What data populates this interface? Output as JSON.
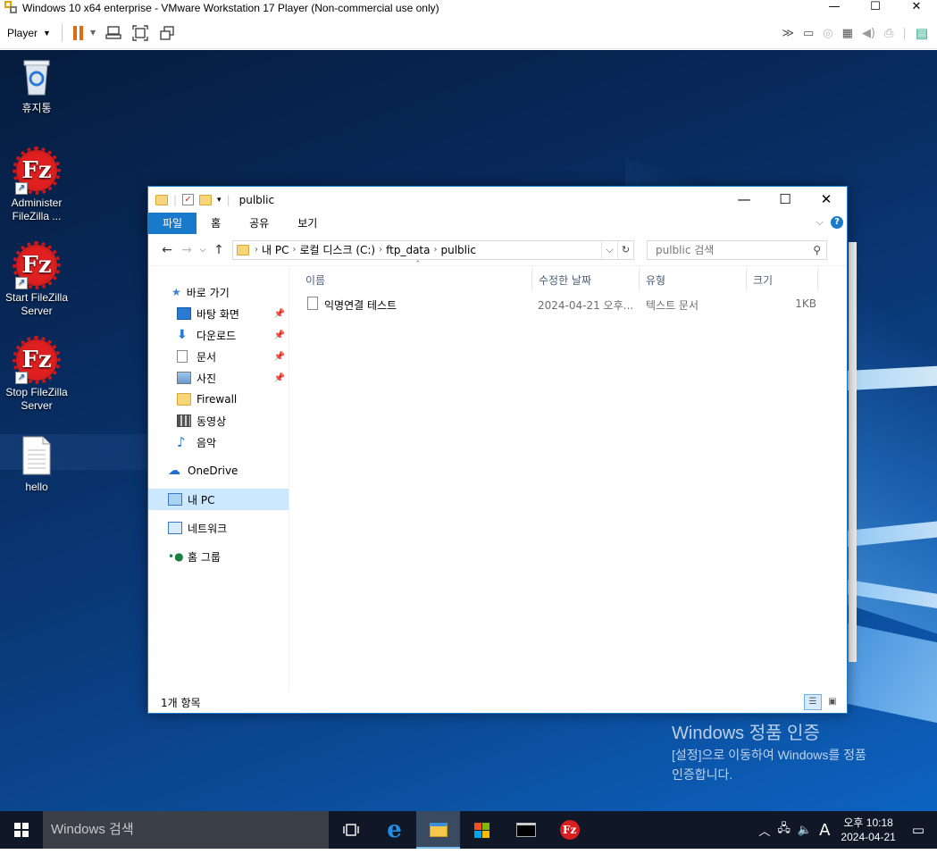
{
  "vm": {
    "title": "Windows 10 x64 enterprise - VMware Workstation 17 Player (Non-commercial use only)",
    "player_menu": "Player",
    "min_glyph": "—",
    "max_glyph": "☐",
    "close_glyph": "✕"
  },
  "desktop": {
    "icons": [
      {
        "label": "휴지통",
        "icon": "recycle-bin-icon"
      },
      {
        "label": "Administer FileZilla ...",
        "icon": "filezilla-icon"
      },
      {
        "label": "Start FileZilla Server",
        "icon": "filezilla-icon"
      },
      {
        "label": "Stop FileZilla Server",
        "icon": "filezilla-icon"
      },
      {
        "label": "hello",
        "icon": "text-file-icon"
      }
    ],
    "watermark_title": "Windows 정품 인증",
    "watermark_line1": "[설정]으로 이동하여 Windows를 정품",
    "watermark_line2": "인증합니다."
  },
  "explorer": {
    "title": "pulblic",
    "tabs": [
      "파일",
      "홈",
      "공유",
      "보기"
    ],
    "breadcrumb": [
      "내 PC",
      "로컬 디스크 (C:)",
      "ftp_data",
      "pulblic"
    ],
    "search_placeholder": "pulblic 검색",
    "nav": {
      "quick_access": "바로 가기",
      "items": [
        "바탕 화면",
        "다운로드",
        "문서",
        "사진",
        "Firewall",
        "동영상",
        "음악"
      ],
      "onedrive": "OneDrive",
      "this_pc": "내 PC",
      "network": "네트워크",
      "homegroup": "홈 그룹"
    },
    "columns": [
      "이름",
      "수정한 날짜",
      "유형",
      "크기"
    ],
    "files": [
      {
        "name": "익명연결 테스트",
        "modified": "2024-04-21 오후...",
        "type": "텍스트 문서",
        "size": "1KB"
      }
    ],
    "status": "1개 항목"
  },
  "taskbar": {
    "search_placeholder": "Windows 검색",
    "ime": "A",
    "time": "오후 10:18",
    "date": "2024-04-21"
  }
}
